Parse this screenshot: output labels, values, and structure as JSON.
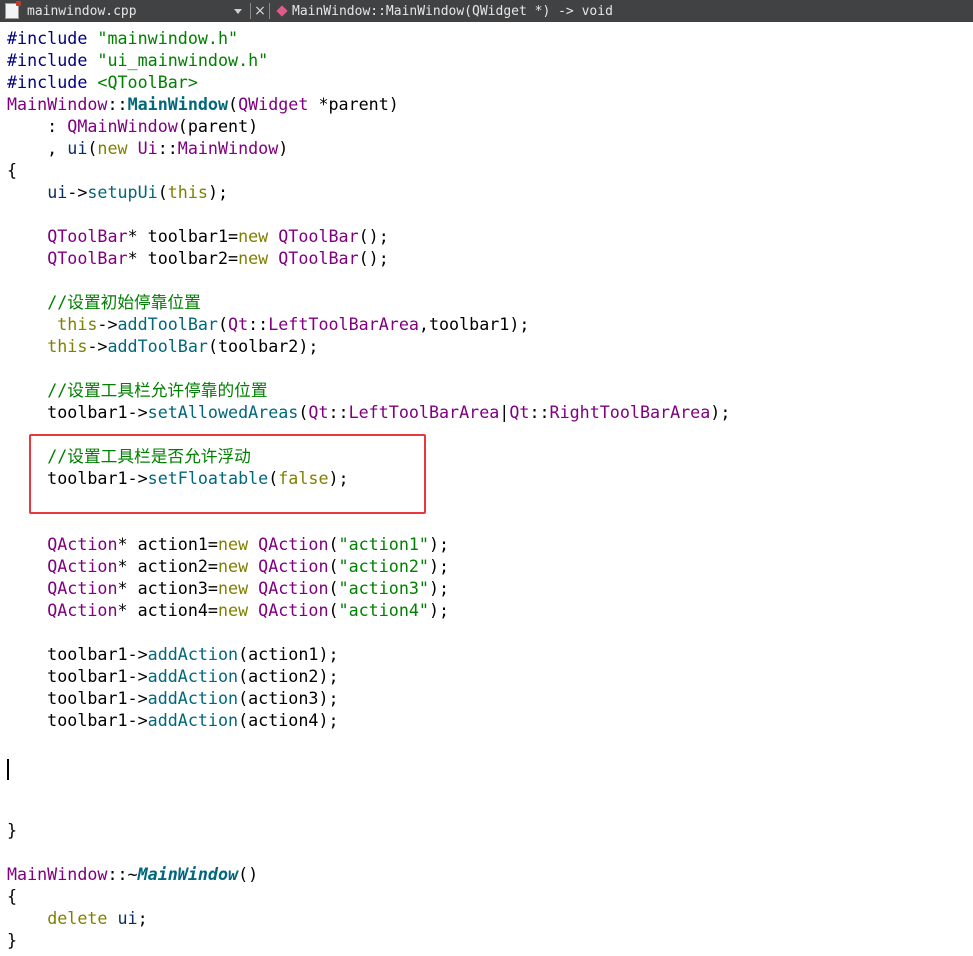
{
  "toolbar": {
    "file_icon": "cpp-file-icon",
    "file_name": "mainwindow.cpp",
    "close_glyph": "×",
    "function_signature": "MainWindow::MainWindow(QWidget *) -> void"
  },
  "colors": {
    "preprocessor": "#000080",
    "string": "#008000",
    "type": "#800080",
    "function": "#00677c",
    "keyword": "#808000",
    "comment": "#008000",
    "highlight_box": "#e8383d",
    "toolbar_bg": "#404244"
  },
  "code_lines": [
    [
      {
        "c": "t-pre",
        "t": "#include "
      },
      {
        "c": "t-str",
        "t": "\"mainwindow.h\""
      }
    ],
    [
      {
        "c": "t-pre",
        "t": "#include "
      },
      {
        "c": "t-str",
        "t": "\"ui_mainwindow.h\""
      }
    ],
    [
      {
        "c": "t-pre",
        "t": "#include "
      },
      {
        "c": "t-str",
        "t": "<QToolBar>"
      }
    ],
    [
      {
        "c": "t-type",
        "t": "MainWindow"
      },
      {
        "c": "t-plain",
        "t": "::"
      },
      {
        "c": "t-bold",
        "t": "MainWindow"
      },
      {
        "c": "t-plain",
        "t": "("
      },
      {
        "c": "t-type",
        "t": "QWidget"
      },
      {
        "c": "t-plain",
        "t": " *parent)"
      }
    ],
    [
      {
        "c": "t-plain",
        "t": "    : "
      },
      {
        "c": "t-type",
        "t": "QMainWindow"
      },
      {
        "c": "t-plain",
        "t": "(parent)"
      }
    ],
    [
      {
        "c": "t-plain",
        "t": "    , "
      },
      {
        "c": "t-mem",
        "t": "ui"
      },
      {
        "c": "t-plain",
        "t": "("
      },
      {
        "c": "t-kw",
        "t": "new"
      },
      {
        "c": "t-plain",
        "t": " "
      },
      {
        "c": "t-type",
        "t": "Ui"
      },
      {
        "c": "t-plain",
        "t": "::"
      },
      {
        "c": "t-type",
        "t": "MainWindow"
      },
      {
        "c": "t-plain",
        "t": ")"
      }
    ],
    [
      {
        "c": "t-plain",
        "t": "{"
      }
    ],
    [
      {
        "c": "t-plain",
        "t": "    "
      },
      {
        "c": "t-mem",
        "t": "ui"
      },
      {
        "c": "t-plain",
        "t": "->"
      },
      {
        "c": "t-func",
        "t": "setupUi"
      },
      {
        "c": "t-plain",
        "t": "("
      },
      {
        "c": "t-kw",
        "t": "this"
      },
      {
        "c": "t-plain",
        "t": ");"
      }
    ],
    [],
    [
      {
        "c": "t-plain",
        "t": "    "
      },
      {
        "c": "t-type",
        "t": "QToolBar"
      },
      {
        "c": "t-plain",
        "t": "* toolbar1="
      },
      {
        "c": "t-kw",
        "t": "new"
      },
      {
        "c": "t-plain",
        "t": " "
      },
      {
        "c": "t-type",
        "t": "QToolBar"
      },
      {
        "c": "t-plain",
        "t": "();"
      }
    ],
    [
      {
        "c": "t-plain",
        "t": "    "
      },
      {
        "c": "t-type",
        "t": "QToolBar"
      },
      {
        "c": "t-plain",
        "t": "* toolbar2="
      },
      {
        "c": "t-kw",
        "t": "new"
      },
      {
        "c": "t-plain",
        "t": " "
      },
      {
        "c": "t-type",
        "t": "QToolBar"
      },
      {
        "c": "t-plain",
        "t": "();"
      }
    ],
    [],
    [
      {
        "c": "t-plain",
        "t": "    "
      },
      {
        "c": "t-com",
        "t": "//设置初始停靠位置"
      }
    ],
    [
      {
        "c": "t-plain",
        "t": "     "
      },
      {
        "c": "t-kw",
        "t": "this"
      },
      {
        "c": "t-plain",
        "t": "->"
      },
      {
        "c": "t-func",
        "t": "addToolBar"
      },
      {
        "c": "t-plain",
        "t": "("
      },
      {
        "c": "t-type",
        "t": "Qt"
      },
      {
        "c": "t-plain",
        "t": "::"
      },
      {
        "c": "t-type",
        "t": "LeftToolBarArea"
      },
      {
        "c": "t-plain",
        "t": ",toolbar1);"
      }
    ],
    [
      {
        "c": "t-plain",
        "t": "    "
      },
      {
        "c": "t-kw",
        "t": "this"
      },
      {
        "c": "t-plain",
        "t": "->"
      },
      {
        "c": "t-func",
        "t": "addToolBar"
      },
      {
        "c": "t-plain",
        "t": "(toolbar2);"
      }
    ],
    [],
    [
      {
        "c": "t-plain",
        "t": "    "
      },
      {
        "c": "t-com",
        "t": "//设置工具栏允许停靠的位置"
      }
    ],
    [
      {
        "c": "t-plain",
        "t": "    toolbar1->"
      },
      {
        "c": "t-func",
        "t": "setAllowedAreas"
      },
      {
        "c": "t-plain",
        "t": "("
      },
      {
        "c": "t-type",
        "t": "Qt"
      },
      {
        "c": "t-plain",
        "t": "::"
      },
      {
        "c": "t-type",
        "t": "LeftToolBarArea"
      },
      {
        "c": "t-plain",
        "t": "|"
      },
      {
        "c": "t-type",
        "t": "Qt"
      },
      {
        "c": "t-plain",
        "t": "::"
      },
      {
        "c": "t-type",
        "t": "RightToolBarArea"
      },
      {
        "c": "t-plain",
        "t": ");"
      }
    ],
    [],
    [
      {
        "c": "t-plain",
        "t": "    "
      },
      {
        "c": "t-com",
        "t": "//设置工具栏是否允许浮动"
      }
    ],
    [
      {
        "c": "t-plain",
        "t": "    toolbar1->"
      },
      {
        "c": "t-func",
        "t": "setFloatable"
      },
      {
        "c": "t-plain",
        "t": "("
      },
      {
        "c": "t-kw",
        "t": "false"
      },
      {
        "c": "t-plain",
        "t": ");"
      }
    ],
    [],
    [],
    [
      {
        "c": "t-plain",
        "t": "    "
      },
      {
        "c": "t-type",
        "t": "QAction"
      },
      {
        "c": "t-plain",
        "t": "* action1="
      },
      {
        "c": "t-kw",
        "t": "new"
      },
      {
        "c": "t-plain",
        "t": " "
      },
      {
        "c": "t-type",
        "t": "QAction"
      },
      {
        "c": "t-plain",
        "t": "("
      },
      {
        "c": "t-str",
        "t": "\"action1\""
      },
      {
        "c": "t-plain",
        "t": ");"
      }
    ],
    [
      {
        "c": "t-plain",
        "t": "    "
      },
      {
        "c": "t-type",
        "t": "QAction"
      },
      {
        "c": "t-plain",
        "t": "* action2="
      },
      {
        "c": "t-kw",
        "t": "new"
      },
      {
        "c": "t-plain",
        "t": " "
      },
      {
        "c": "t-type",
        "t": "QAction"
      },
      {
        "c": "t-plain",
        "t": "("
      },
      {
        "c": "t-str",
        "t": "\"action2\""
      },
      {
        "c": "t-plain",
        "t": ");"
      }
    ],
    [
      {
        "c": "t-plain",
        "t": "    "
      },
      {
        "c": "t-type",
        "t": "QAction"
      },
      {
        "c": "t-plain",
        "t": "* action3="
      },
      {
        "c": "t-kw",
        "t": "new"
      },
      {
        "c": "t-plain",
        "t": " "
      },
      {
        "c": "t-type",
        "t": "QAction"
      },
      {
        "c": "t-plain",
        "t": "("
      },
      {
        "c": "t-str",
        "t": "\"action3\""
      },
      {
        "c": "t-plain",
        "t": ");"
      }
    ],
    [
      {
        "c": "t-plain",
        "t": "    "
      },
      {
        "c": "t-type",
        "t": "QAction"
      },
      {
        "c": "t-plain",
        "t": "* action4="
      },
      {
        "c": "t-kw",
        "t": "new"
      },
      {
        "c": "t-plain",
        "t": " "
      },
      {
        "c": "t-type",
        "t": "QAction"
      },
      {
        "c": "t-plain",
        "t": "("
      },
      {
        "c": "t-str",
        "t": "\"action4\""
      },
      {
        "c": "t-plain",
        "t": ");"
      }
    ],
    [],
    [
      {
        "c": "t-plain",
        "t": "    toolbar1->"
      },
      {
        "c": "t-func",
        "t": "addAction"
      },
      {
        "c": "t-plain",
        "t": "(action1);"
      }
    ],
    [
      {
        "c": "t-plain",
        "t": "    toolbar1->"
      },
      {
        "c": "t-func",
        "t": "addAction"
      },
      {
        "c": "t-plain",
        "t": "(action2);"
      }
    ],
    [
      {
        "c": "t-plain",
        "t": "    toolbar1->"
      },
      {
        "c": "t-func",
        "t": "addAction"
      },
      {
        "c": "t-plain",
        "t": "(action3);"
      }
    ],
    [
      {
        "c": "t-plain",
        "t": "    toolbar1->"
      },
      {
        "c": "t-func",
        "t": "addAction"
      },
      {
        "c": "t-plain",
        "t": "(action4);"
      }
    ],
    [],
    [],
    [],
    [],
    [
      {
        "c": "t-plain",
        "t": "}"
      }
    ],
    [],
    [
      {
        "c": "t-type",
        "t": "MainWindow"
      },
      {
        "c": "t-plain",
        "t": "::~"
      },
      {
        "c": "t-italic",
        "t": "MainWindow"
      },
      {
        "c": "t-plain",
        "t": "()"
      }
    ],
    [
      {
        "c": "t-plain",
        "t": "{"
      }
    ],
    [
      {
        "c": "t-plain",
        "t": "    "
      },
      {
        "c": "t-kw",
        "t": "delete"
      },
      {
        "c": "t-plain",
        "t": " "
      },
      {
        "c": "t-mem",
        "t": "ui"
      },
      {
        "c": "t-plain",
        "t": ";"
      }
    ],
    [
      {
        "c": "t-plain",
        "t": "}"
      }
    ]
  ]
}
